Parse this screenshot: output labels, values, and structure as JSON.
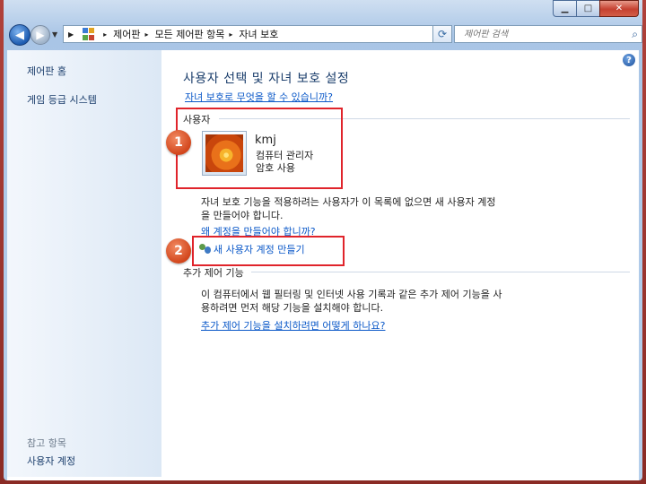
{
  "window": {
    "minimize_glyph": "▁",
    "maximize_glyph": "□",
    "close_glyph": "✕"
  },
  "address_bar": {
    "breadcrumbs": [
      "제어판",
      "모든 제어판 항목",
      "자녀 보호"
    ],
    "separator": "▸"
  },
  "search": {
    "placeholder": "제어판 검색",
    "icon": "search-icon"
  },
  "sidebar": {
    "items": [
      {
        "label": "제어판 홈"
      },
      {
        "label": "게임 등급 시스템"
      }
    ],
    "see_also_heading": "참고 항목",
    "see_also_items": [
      {
        "label": "사용자 계정"
      }
    ]
  },
  "main": {
    "title": "사용자 선택 및 자녀 보호 설정",
    "help_link": "자녀 보호로 무엇을 할 수 있습니까?",
    "users_section": {
      "heading": "사용자",
      "user": {
        "name": "kmj",
        "role": "컴퓨터 관리자",
        "status": "암호 사용"
      },
      "info_line1": "자녀 보호 기능을 적용하려는 사용자가 이 목록에 없으면 새 사용자 계정",
      "info_line2": "을 만들어야 합니다.",
      "why_link": "왜 계정을 만들어야 합니까?",
      "create_link": "새 사용자 계정 만들기"
    },
    "extra_section": {
      "heading": "추가 제어 기능",
      "info_line1": "이 컴퓨터에서 웹 필터링 및 인터넷 사용 기록과 같은 추가 제어 기능을 사",
      "info_line2": "용하려면 먼저 해당 기능을  설치해야 합니다.",
      "install_link": "추가 제어 기능을 설치하려면 어떻게 하나요?"
    }
  },
  "annotations": [
    {
      "number": "1"
    },
    {
      "number": "2"
    }
  ],
  "colors": {
    "frame": "#8a2b25",
    "link": "#0a58c8",
    "highlight_box": "#e0242b",
    "badge": "#d2461c"
  }
}
